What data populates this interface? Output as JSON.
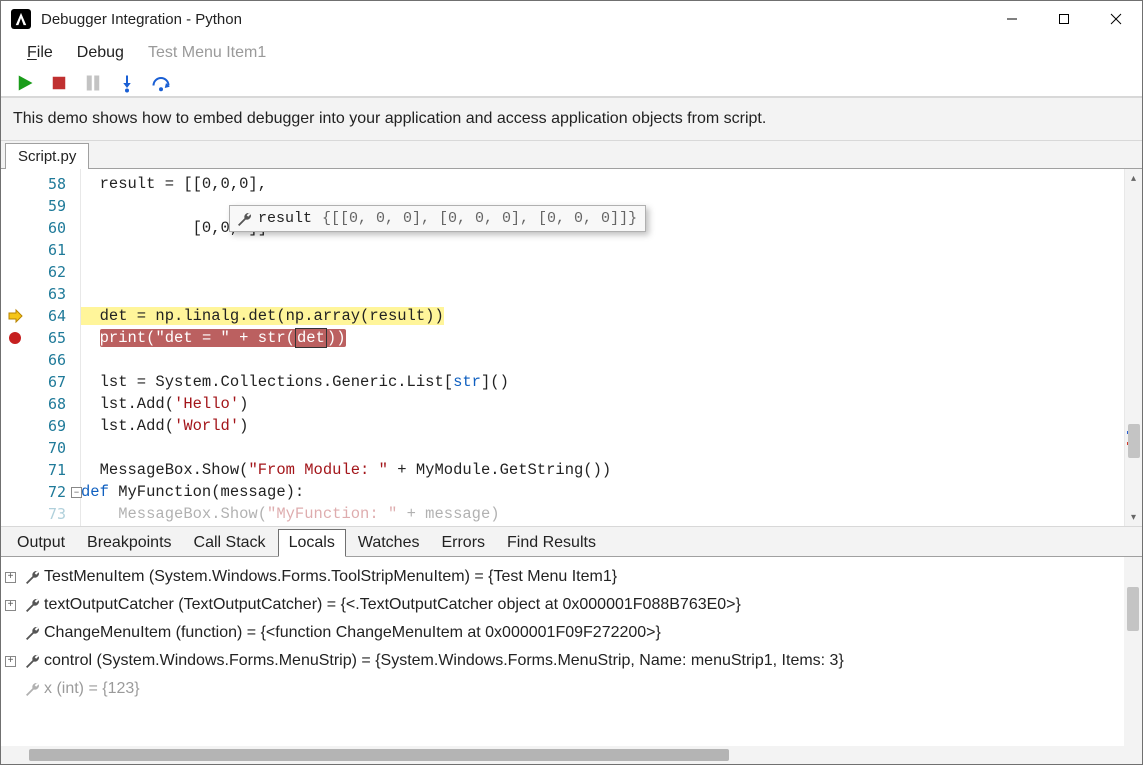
{
  "window": {
    "title": "Debugger Integration - Python"
  },
  "menu": {
    "file": "File",
    "file_underline_first": "F",
    "file_rest_chars": "ile",
    "debug": "Debug",
    "test_item": "Test Menu Item1"
  },
  "description": "This demo shows how to embed debugger into your application and access application objects from script.",
  "editor": {
    "tab_label": "Script.py",
    "lines": {
      "l58": "58",
      "l59": "59",
      "l60": "60",
      "l61": "61",
      "l62": "62",
      "l63": "63",
      "l64": "64",
      "l65": "65",
      "l66": "66",
      "l67": "67",
      "l68": "68",
      "l69": "69",
      "l70": "70",
      "l71": "71",
      "l72": "72",
      "l73": "73"
    },
    "code": {
      "c58": "  result = [[0,0,0],",
      "c59": "",
      "c60": "            [0,0,0]]",
      "c61": "",
      "c62": "",
      "c63": "",
      "c64_text": "  det = np.linalg.det(np.array(result))",
      "c65_pre": "  ",
      "c65_print": "print",
      "c65_open": "(",
      "c65_str": "\"det = \"",
      "c65_plus": " + ",
      "c65_strfn": "str",
      "c65_open2": "(",
      "c65_var": "det",
      "c65_close": "))",
      "c66": "",
      "c67_pre": "  lst = System.Collections.Generic.List[",
      "c67_type": "str",
      "c67_post": "]()",
      "c68_pre": "  lst.Add(",
      "c68_str": "'Hello'",
      "c68_post": ")",
      "c69_pre": "  lst.Add(",
      "c69_str": "'World'",
      "c69_post": ")",
      "c70": "",
      "c71_pre": "  MessageBox.Show(",
      "c71_str": "\"From Module: \"",
      "c71_post": " + MyModule.GetString())",
      "c72_def": "def",
      "c72_rest": " MyFunction(message):",
      "c73_pre": "    MessageBox.Show(",
      "c73_str": "\"MyFunction: \"",
      "c73_post": " + message)"
    },
    "hover": {
      "name": "result",
      "value": "{[[0, 0, 0], [0, 0, 0], [0, 0, 0]]}"
    }
  },
  "panel": {
    "tabs": {
      "output": "Output",
      "breakpoints": "Breakpoints",
      "callstack": "Call Stack",
      "locals": "Locals",
      "watches": "Watches",
      "errors": "Errors",
      "find": "Find Results"
    },
    "locals": [
      {
        "expandable": true,
        "text": "TestMenuItem (System.Windows.Forms.ToolStripMenuItem) = {Test Menu Item1}"
      },
      {
        "expandable": true,
        "text": "textOutputCatcher (TextOutputCatcher) = {<.TextOutputCatcher object at 0x000001F088B763E0>}"
      },
      {
        "expandable": false,
        "text": "ChangeMenuItem (function) = {<function ChangeMenuItem at 0x000001F09F272200>}"
      },
      {
        "expandable": true,
        "text": "control (System.Windows.Forms.MenuStrip) = {System.Windows.Forms.MenuStrip, Name: menuStrip1, Items: 3}"
      },
      {
        "expandable": false,
        "text": "x (int) = {123}"
      }
    ]
  }
}
